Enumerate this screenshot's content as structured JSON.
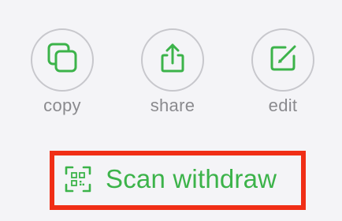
{
  "colors": {
    "background": "#f4f4f7",
    "accent_green": "#3cb34a",
    "circle_border": "#c7c7cc",
    "label_gray": "#8a8a8e",
    "highlight_red": "#f02e16"
  },
  "actions": [
    {
      "label": "copy",
      "icon": "copy-icon"
    },
    {
      "label": "share",
      "icon": "share-icon"
    },
    {
      "label": "edit",
      "icon": "edit-icon"
    }
  ],
  "scan": {
    "label": "Scan withdraw",
    "icon": "qr-scan-icon"
  }
}
